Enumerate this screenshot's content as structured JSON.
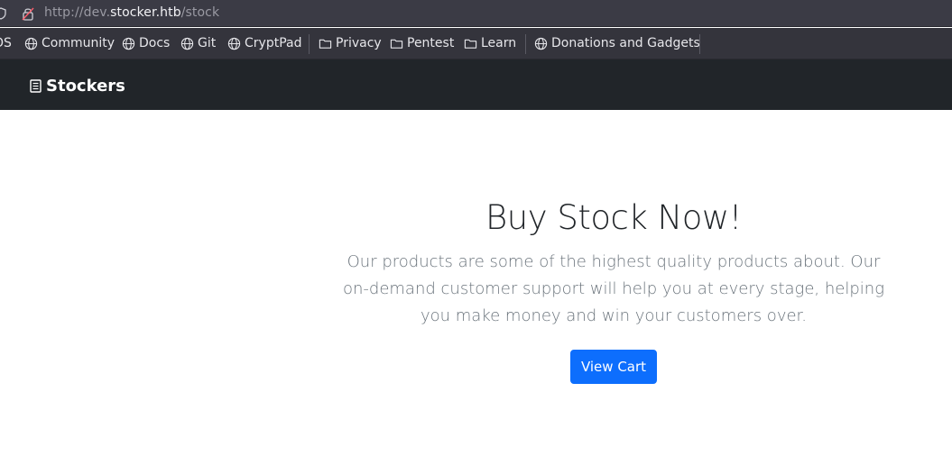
{
  "browser": {
    "url_prefix": "http://dev.",
    "url_host": "stocker.htb",
    "url_path": "/stock"
  },
  "bookmarks": {
    "items": [
      {
        "label": "OS",
        "icon": "globe-icon"
      },
      {
        "label": "Community",
        "icon": "globe-icon"
      },
      {
        "label": "Docs",
        "icon": "globe-icon"
      },
      {
        "label": "Git",
        "icon": "globe-icon"
      },
      {
        "label": "CryptPad",
        "icon": "globe-icon"
      },
      {
        "label": "Privacy",
        "icon": "folder-icon"
      },
      {
        "label": "Pentest",
        "icon": "folder-icon"
      },
      {
        "label": "Learn",
        "icon": "folder-icon"
      },
      {
        "label": "Donations and Gadgets",
        "icon": "globe-icon"
      }
    ]
  },
  "navbar": {
    "brand": "Stockers",
    "bg_color": "#212529"
  },
  "hero": {
    "title": "Buy Stock Now!",
    "lead": "Our products are some of the highest quality products about. Our on-demand customer support will help you at every stage, helping you make money and win your customers over.",
    "button_label": "View Cart",
    "button_color": "#0d6efd"
  }
}
